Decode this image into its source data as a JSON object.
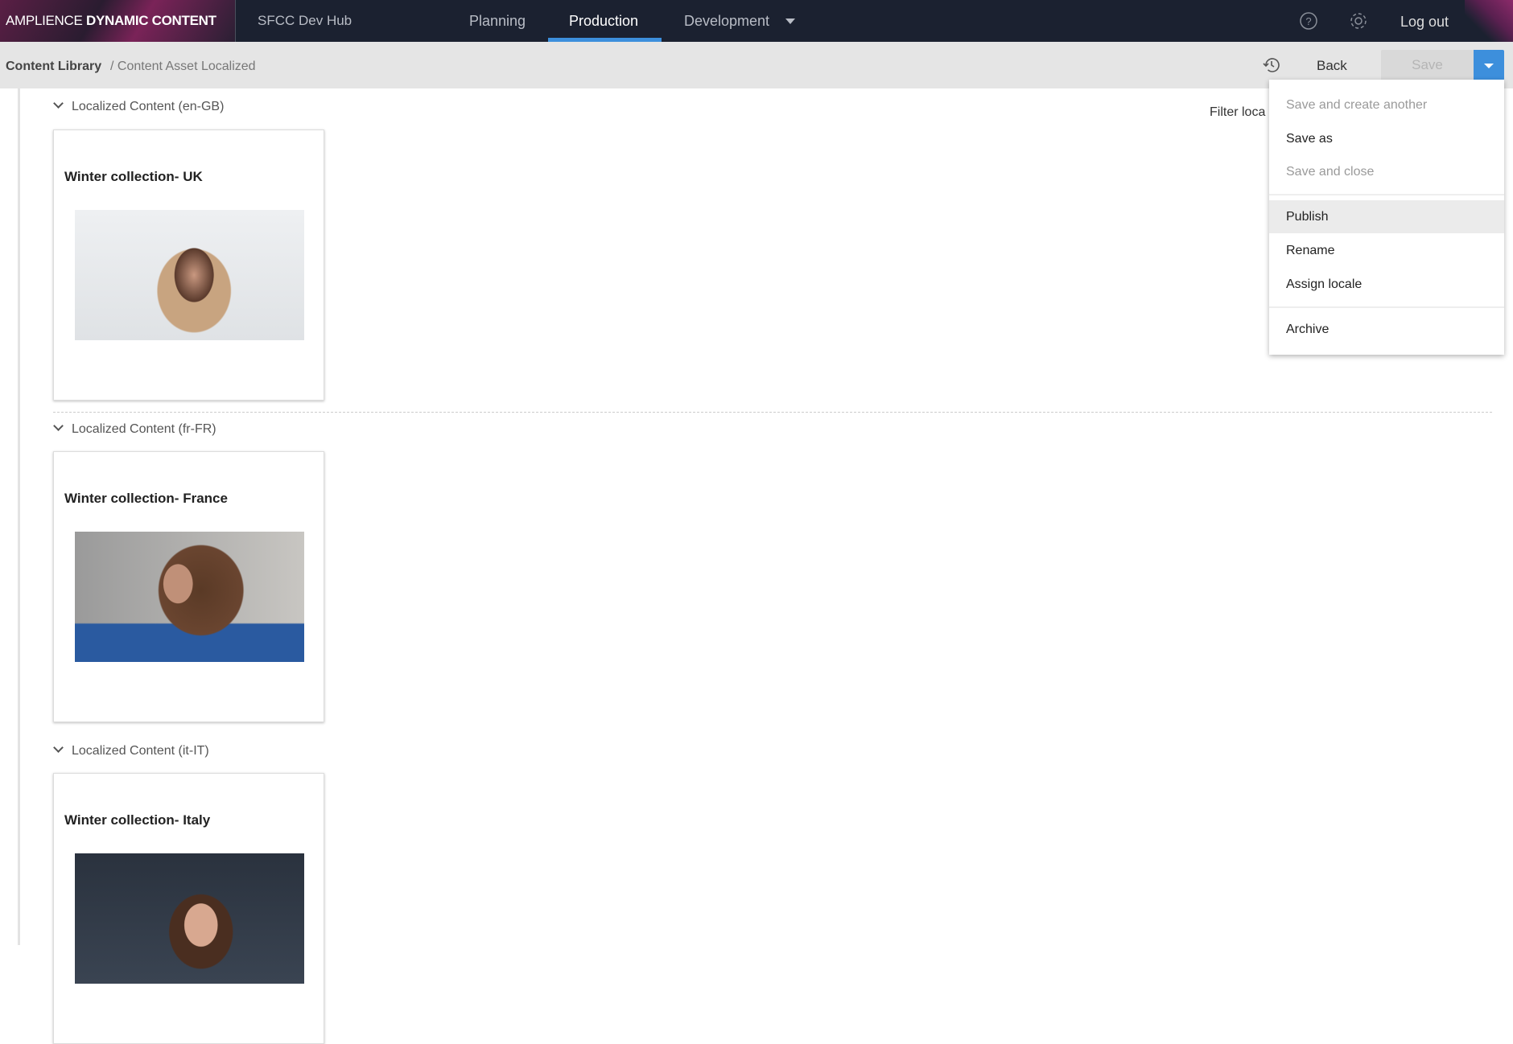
{
  "header": {
    "brand_light": "AMPLIENCE",
    "brand_bold": "DYNAMIC CONTENT",
    "hub": "SFCC Dev Hub",
    "nav": [
      {
        "label": "Planning"
      },
      {
        "label": "Production",
        "active": true
      },
      {
        "label": "Development"
      }
    ],
    "logout": "Log out",
    "accent": "#3d8fdc"
  },
  "breadcrumb": {
    "root": "Content Library",
    "current": "/ Content Asset Localized"
  },
  "toolbar": {
    "back": "Back",
    "save": "Save"
  },
  "filter_label": "Filter loca",
  "sections": [
    {
      "heading": "Localized Content (en-GB)",
      "card_title": "Winter collection- UK"
    },
    {
      "heading": "Localized Content (fr-FR)",
      "card_title": "Winter collection- France"
    },
    {
      "heading": "Localized Content (it-IT)",
      "card_title": "Winter collection- Italy"
    }
  ],
  "menu": {
    "items": [
      {
        "label": "Save and create another",
        "disabled": true
      },
      {
        "label": "Save as"
      },
      {
        "label": "Save and close",
        "disabled": true
      },
      {
        "label": "Publish",
        "highlighted": true
      },
      {
        "label": "Rename"
      },
      {
        "label": "Assign locale"
      },
      {
        "label": "Archive"
      }
    ]
  }
}
